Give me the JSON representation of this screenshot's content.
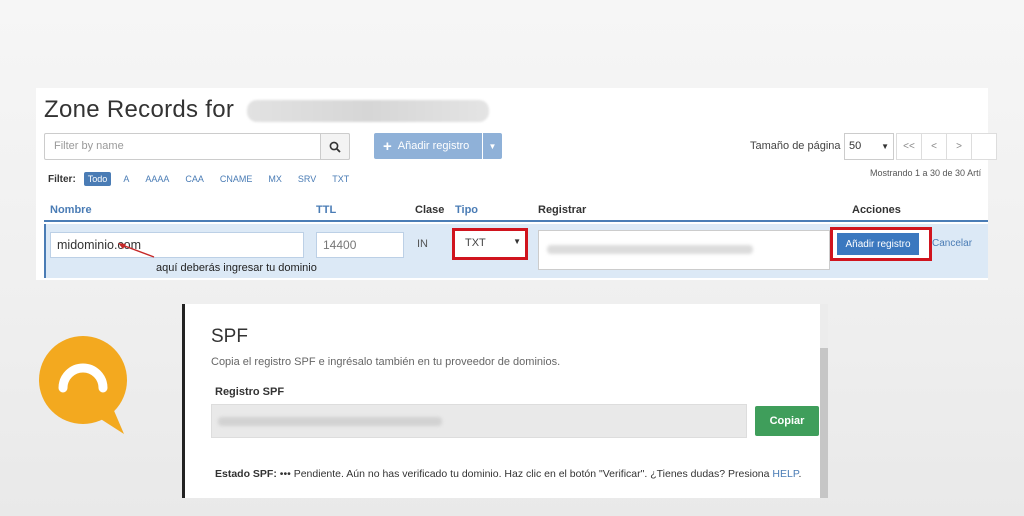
{
  "zone": {
    "title": "Zone Records for",
    "search_placeholder": "Filter by name",
    "add_label": "Añadir registro",
    "page_size_label": "Tamaño de página",
    "page_size_value": "50",
    "pager": [
      "<<",
      "<",
      ">"
    ],
    "showing": "Mostrando 1 a 30 de 30 Artí",
    "filter_label": "Filter:",
    "filters": [
      "Todo",
      "A",
      "AAAA",
      "CAA",
      "CNAME",
      "MX",
      "SRV",
      "TXT"
    ],
    "columns": {
      "nombre": "Nombre",
      "ttl": "TTL",
      "clase": "Clase",
      "tipo": "Tipo",
      "registrar": "Registrar",
      "acciones": "Acciones"
    },
    "row": {
      "name": "midominio.com",
      "ttl": "14400",
      "clase": "IN",
      "tipo": "TXT",
      "action": "Añadir registro",
      "cancel": "Cancelar"
    },
    "annotation": "aquí deberás ingresar tu dominio"
  },
  "spf": {
    "title": "SPF",
    "description": "Copia el registro SPF e ingrésalo también en tu proveedor de dominios.",
    "label": "Registro SPF",
    "copy": "Copiar",
    "status_label": "Estado SPF:",
    "status_text": "••• Pendiente. Aún no has verificado tu dominio. Haz clic en el botón \"Verificar\". ¿Tienes dudas? Presiona",
    "help": "HELP",
    "help_tail": "."
  },
  "colors": {
    "accent": "#4a7cb5",
    "highlight": "#d0141e",
    "copy_green": "#3f9e5b",
    "logo": "#f3a91f"
  },
  "icons": {
    "search": "search-icon",
    "plus": "plus-icon",
    "caret": "caret-down-icon",
    "logo": "chat-bubble-logo"
  }
}
